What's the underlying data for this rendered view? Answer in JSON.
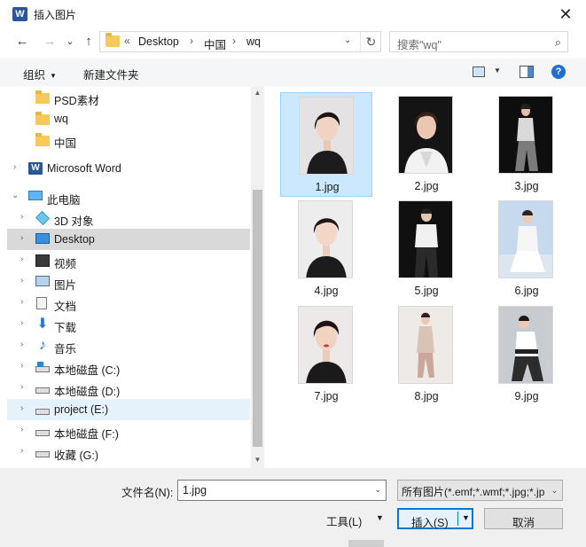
{
  "window": {
    "app_icon_letter": "W",
    "title": "插入图片",
    "close_glyph": "✕"
  },
  "nav": {
    "back": "←",
    "forward": "→",
    "recent": "⌄",
    "up": "↑",
    "breadcrumb_overflow": "«",
    "path": [
      "Desktop",
      "中国",
      "wq"
    ],
    "separator": "›",
    "address_dropdown": "⌄",
    "refresh": "↻",
    "search_placeholder": "搜索\"wq\"",
    "search_icon": "⌕"
  },
  "toolbar": {
    "organize": "组织",
    "organize_arrow": "▼",
    "new_folder": "新建文件夹",
    "view_arrow": "▼",
    "help": "?"
  },
  "sidebar": {
    "chev_collapsed": "›",
    "chev_expanded": "⌄",
    "items": [
      {
        "label": "PSD素材",
        "icon": "folder-icon"
      },
      {
        "label": "wq",
        "icon": "folder-icon"
      },
      {
        "label": "中国",
        "icon": "folder-icon"
      },
      {
        "label": "Microsoft Word",
        "icon": "word-icon",
        "icon_text": "W"
      },
      {
        "label": "此电脑",
        "icon": "this-pc-icon"
      },
      {
        "label": "3D 对象",
        "icon": "3d-objects-icon"
      },
      {
        "label": "Desktop",
        "icon": "desktop-icon"
      },
      {
        "label": "视频",
        "icon": "video-icon"
      },
      {
        "label": "图片",
        "icon": "pictures-icon"
      },
      {
        "label": "文档",
        "icon": "documents-icon"
      },
      {
        "label": "下载",
        "icon": "download-icon",
        "icon_text": "⬇"
      },
      {
        "label": "音乐",
        "icon": "music-icon",
        "icon_text": "♪"
      },
      {
        "label": "本地磁盘 (C:)",
        "icon": "windows-drive-icon"
      },
      {
        "label": "本地磁盘 (D:)",
        "icon": "drive-icon"
      },
      {
        "label": "project (E:)",
        "icon": "drive-icon"
      },
      {
        "label": "本地磁盘 (F:)",
        "icon": "drive-icon"
      },
      {
        "label": "收藏 (G:)",
        "icon": "drive-icon"
      }
    ]
  },
  "scrollbar": {
    "up": "▲",
    "down": "▼"
  },
  "files": [
    {
      "name": "1.jpg",
      "selected": true
    },
    {
      "name": "2.jpg"
    },
    {
      "name": "3.jpg"
    },
    {
      "name": "4.jpg"
    },
    {
      "name": "5.jpg"
    },
    {
      "name": "6.jpg"
    },
    {
      "name": "7.jpg"
    },
    {
      "name": "8.jpg"
    },
    {
      "name": "9.jpg"
    }
  ],
  "footer": {
    "filename_label": "文件名(N):",
    "filename_value": "1.jpg",
    "filename_drop": "⌄",
    "filetype_value": "所有图片(*.emf;*.wmf;*.jpg;*.jp",
    "filetype_drop": "⌄",
    "tools": "工具(L)",
    "tools_arrow": "▼",
    "insert": "插入(S)",
    "insert_arrow": "▼",
    "cancel": "取消"
  }
}
